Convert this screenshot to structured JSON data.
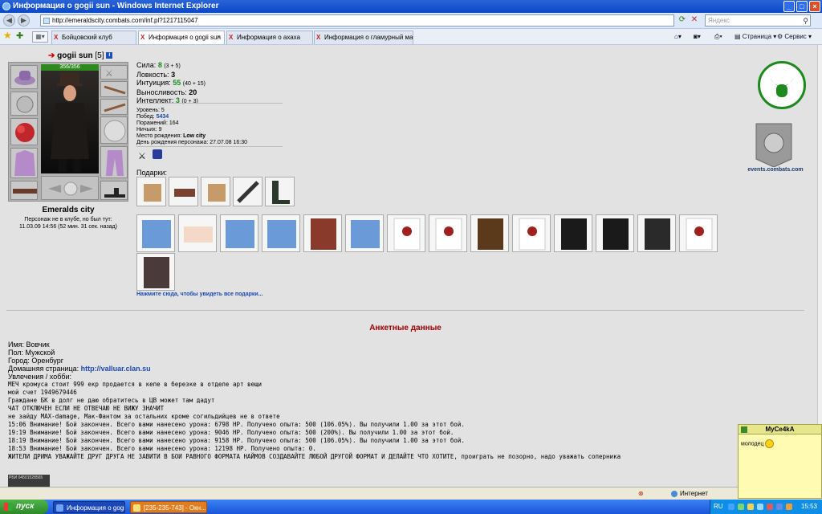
{
  "window": {
    "title": "Информация о gogii sun - Windows Internet Explorer"
  },
  "address": {
    "url": "http://emeraldscity.combats.com/inf.pl?1217115047",
    "search_placeholder": "Яндекс"
  },
  "tabs": [
    {
      "label": "Бойцовский клуб"
    },
    {
      "label": "Информация о gogii sun"
    },
    {
      "label": "Информация о ахаха"
    },
    {
      "label": "Информация о гламурный маг"
    }
  ],
  "toolbar": {
    "page": "Страница",
    "service": "Сервис"
  },
  "player": {
    "name": "gogii sun",
    "level": "[5]",
    "hp": "356/356",
    "city": "Emeralds city",
    "status": "Персонаж не в клубе, но был тут:",
    "lastseen": "11.03.09 14:56 (52 мин. 31 сек. назад)"
  },
  "stats": [
    {
      "label": "Сила:",
      "value": "8",
      "extra": "(3 + 5)"
    },
    {
      "label": "Ловкость:",
      "value": "3",
      "extra": ""
    },
    {
      "label": "Интуиция:",
      "value": "55",
      "extra": "(40 + 15)"
    },
    {
      "label": "Выносливость:",
      "value": "20",
      "extra": ""
    },
    {
      "label": "Интеллект:",
      "value": "3",
      "extra": "(0 + 3)"
    }
  ],
  "info": {
    "level_l": "Уровень:",
    "level": "5",
    "wins_l": "Побед:",
    "wins": "5434",
    "losses_l": "Поражений:",
    "losses": "164",
    "draws_l": "Ничьих:",
    "draws": "9",
    "birth_l": "Место рождения:",
    "birth": "Low city",
    "bday_l": "День рождения персонажа:",
    "bday": "27.07.08 16:30"
  },
  "gifts_label": "Подарки:",
  "all_gifts_link": "Нажмите сюда, чтобы увидеть все подарки...",
  "survey": {
    "title": "Анкетные данные",
    "name_l": "Имя:",
    "name": "Вовчик",
    "sex_l": "Пол:",
    "sex": "Мужской",
    "city_l": "Город:",
    "city": "Оренбург",
    "home_l": "Домашняя страница:",
    "home": "http://valluar.clan.su",
    "hobby_l": "Увлечения / хобби:",
    "lines": [
      "МЕЧ кромуса стоит 999 екр продается в кепе в березке в отделе арт вещи",
      "мой счет 1949679446",
      "Граждане БК в долг не даю обратитесь в ЦВ может там дадут",
      "ЧАТ ОТКЛЮЧЕН ЕСЛИ НЕ ОТВЕЧАЮ НЕ ВИЖУ ЗНАЧИТ",
      "не зайду МАХ-damage, Мак-Фантом за остальних кроме согильдийцев не в ответе",
      "15:06 Внимание! Бой закончен. Всего вами нанесено урона: 6798 HP. Получено опыта: 500 (106.05%). Вы получили  1.00 за этот бой.",
      "19:19 Внимание! Бой закончен. Всего вами нанесено урона: 9046 HP. Получено опыта: 500 (200%). Вы получили 1.00 за этот бой.",
      "18:19 Внимание! Бой закончен. Всего вами нанесено урона: 9158 HP. Получено опыта: 500 (106.05%). Вы получили 1.00 за этот бой.",
      "18:53 Внимание! Бой закончен. Всего вами нанесено урона: 12198 HP. Получено опыта: 0.",
      "ЖИТЕЛИ ДРИМА УВАЖАЙТЕ ДРУГ ДРУГА НЕ ЗАВИТИ В БОИ РАВНОГО ФОРМАТА НАЙМОВ СОЗДАВАЙТЕ ЛЮБОЙ ДРУГОЙ ФОРМАТ И ДЕЛАЙТЕ ЧТО ХОТИТЕ, проиграть не позорно, надо уважать соперника"
    ]
  },
  "sidebar": {
    "events": "events.combats.com"
  },
  "counter": "РБИ 04501528565",
  "statusbar": {
    "zone": "Интернет",
    "zoom": "▾"
  },
  "popup": {
    "title": "MyCe4kA",
    "message": "молодец"
  },
  "taskbar": {
    "start": "пуск",
    "items": [
      {
        "label": "Информация о gogii ..."
      },
      {
        "label": "[235-235-743] - Окн..."
      }
    ],
    "lang": "RU",
    "clock": "15:53"
  }
}
